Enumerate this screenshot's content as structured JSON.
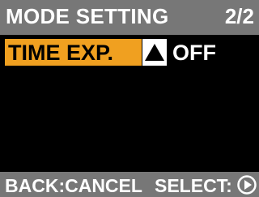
{
  "header": {
    "title": "MODE SETTING",
    "page": "2/2"
  },
  "menu": {
    "item_label": "TIME EXP.",
    "item_value": "OFF",
    "selected_color": "#f0a020",
    "arrow_icon": "triangle-up-icon"
  },
  "footer": {
    "back_label": "BACK:CANCEL",
    "select_label": "SELECT:",
    "select_icon": "play-circle-icon"
  },
  "colors": {
    "background": "#000000",
    "bar": "#777777",
    "text": "#ffffff"
  }
}
